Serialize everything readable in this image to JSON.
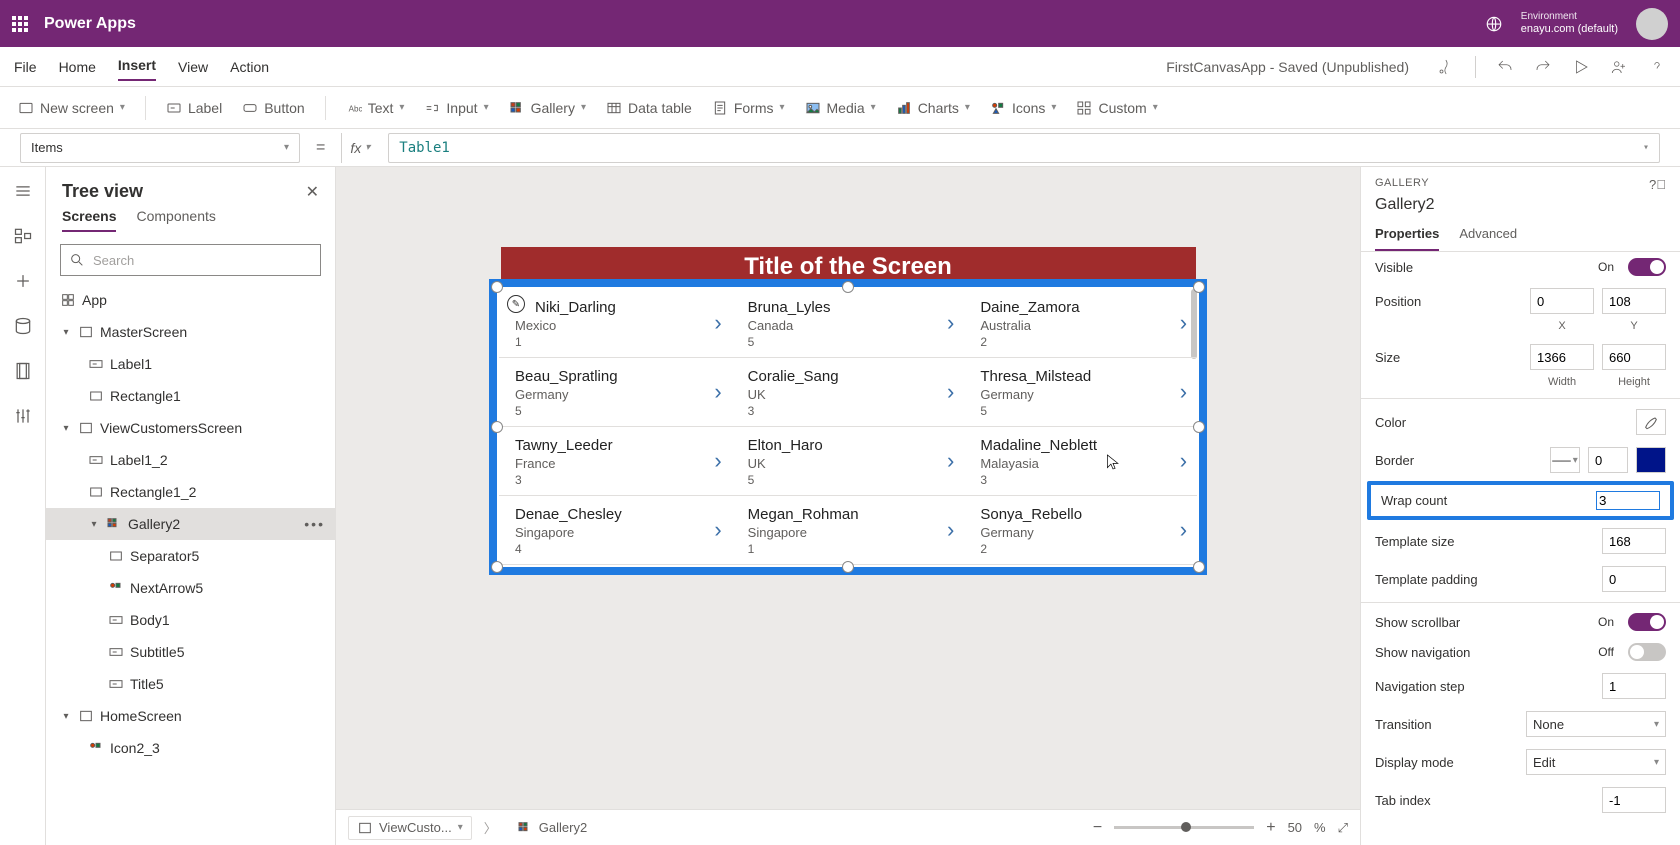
{
  "header": {
    "appName": "Power Apps",
    "envLabel": "Environment",
    "envValue": "enayu.com (default)"
  },
  "menubar": {
    "items": [
      "File",
      "Home",
      "Insert",
      "View",
      "Action"
    ],
    "activeIndex": 2,
    "docName": "FirstCanvasApp - Saved (Unpublished)"
  },
  "ribbon": {
    "newScreen": "New screen",
    "label": "Label",
    "button": "Button",
    "text": "Text",
    "input": "Input",
    "gallery": "Gallery",
    "dataTable": "Data table",
    "forms": "Forms",
    "media": "Media",
    "charts": "Charts",
    "icons": "Icons",
    "custom": "Custom"
  },
  "formulaBar": {
    "property": "Items",
    "fx": "fx",
    "formula": "Table1"
  },
  "tree": {
    "title": "Tree view",
    "tabs": [
      "Screens",
      "Components"
    ],
    "searchPlaceholder": "Search",
    "nodes": {
      "app": "App",
      "masterScreen": "MasterScreen",
      "label1": "Label1",
      "rect1": "Rectangle1",
      "viewCust": "ViewCustomersScreen",
      "label12": "Label1_2",
      "rect12": "Rectangle1_2",
      "gallery2": "Gallery2",
      "sep5": "Separator5",
      "next5": "NextArrow5",
      "body1": "Body1",
      "subtitle5": "Subtitle5",
      "title5": "Title5",
      "home": "HomeScreen",
      "icon23": "Icon2_3"
    }
  },
  "canvas": {
    "screenTitle": "Title of the Screen",
    "rows": [
      [
        {
          "name": "Niki_Darling",
          "sub": "Mexico",
          "num": "1",
          "first": true
        },
        {
          "name": "Bruna_Lyles",
          "sub": "Canada",
          "num": "5"
        },
        {
          "name": "Daine_Zamora",
          "sub": "Australia",
          "num": "2"
        }
      ],
      [
        {
          "name": "Beau_Spratling",
          "sub": "Germany",
          "num": "5"
        },
        {
          "name": "Coralie_Sang",
          "sub": "UK",
          "num": "3"
        },
        {
          "name": "Thresa_Milstead",
          "sub": "Germany",
          "num": "5"
        }
      ],
      [
        {
          "name": "Tawny_Leeder",
          "sub": "France",
          "num": "3"
        },
        {
          "name": "Elton_Haro",
          "sub": "UK",
          "num": "5"
        },
        {
          "name": "Madaline_Neblett",
          "sub": "Malayasia",
          "num": "3"
        }
      ],
      [
        {
          "name": "Denae_Chesley",
          "sub": "Singapore",
          "num": "4"
        },
        {
          "name": "Megan_Rohman",
          "sub": "Singapore",
          "num": "1"
        },
        {
          "name": "Sonya_Rebello",
          "sub": "Germany",
          "num": "2"
        }
      ]
    ]
  },
  "props": {
    "category": "GALLERY",
    "name": "Gallery2",
    "tabs": [
      "Properties",
      "Advanced"
    ],
    "visible": {
      "label": "Visible",
      "state": "On"
    },
    "position": {
      "label": "Position",
      "x": "0",
      "y": "108",
      "xl": "X",
      "yl": "Y"
    },
    "size": {
      "label": "Size",
      "w": "1366",
      "h": "660",
      "wl": "Width",
      "hl": "Height"
    },
    "color": {
      "label": "Color"
    },
    "border": {
      "label": "Border",
      "val": "0"
    },
    "wrap": {
      "label": "Wrap count",
      "val": "3"
    },
    "tsize": {
      "label": "Template size",
      "val": "168"
    },
    "tpad": {
      "label": "Template padding",
      "val": "0"
    },
    "scroll": {
      "label": "Show scrollbar",
      "state": "On"
    },
    "nav": {
      "label": "Show navigation",
      "state": "Off"
    },
    "nstep": {
      "label": "Navigation step",
      "val": "1"
    },
    "trans": {
      "label": "Transition",
      "val": "None"
    },
    "dmode": {
      "label": "Display mode",
      "val": "Edit"
    },
    "tab": {
      "label": "Tab index",
      "val": "-1"
    }
  },
  "status": {
    "crumb1": "ViewCusto...",
    "crumb2": "Gallery2",
    "zoom": "50",
    "pct": "%"
  }
}
